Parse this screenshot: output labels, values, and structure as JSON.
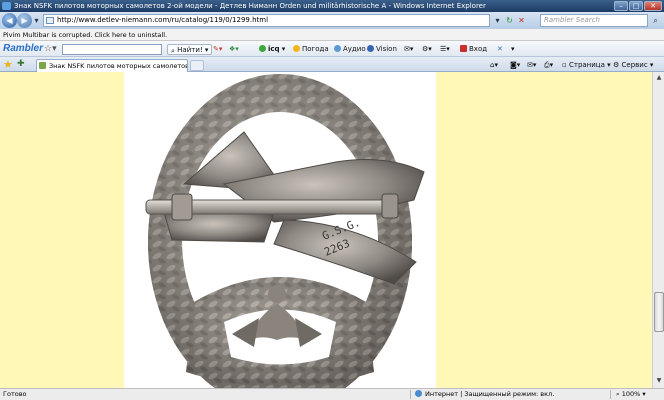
{
  "window": {
    "title": "Знак NSFK пилотов моторных самолетов 2-ой модели - Детлев Ниманн Orden und militärhistorische A - Windows Internet Explorer"
  },
  "address_bar": {
    "url": "http://www.detlev-niemann.com/ru/catalog/119/0/1299.html",
    "search_placeholder": "Rambler Search"
  },
  "info_bar": {
    "message": "Pivim Multibar is corrupted. Click here to uninstall."
  },
  "rambler_toolbar": {
    "logo": "Rambler",
    "find_label": "Найти!",
    "icq_label": "icq",
    "weather_label": "Погода",
    "audio_label": "Аудио",
    "vision_label": "Vision",
    "login_label": "Вход"
  },
  "tab_bar": {
    "active_tab": "Знак NSFK пилотов моторных самолетов 2-ой ...",
    "page_menu": "Страница",
    "tools_menu": "Сервис"
  },
  "badge_inscription": {
    "line1": "G.S.G.",
    "line2": "2263"
  },
  "status_bar": {
    "status": "Готово",
    "zone": "Интернет | Защищенный режим: вкл.",
    "zoom": "100%"
  },
  "colors": {
    "page_background": "#fff8b6",
    "titlebar": "#1d3b64",
    "rambler_blue": "#2b6fc7"
  }
}
